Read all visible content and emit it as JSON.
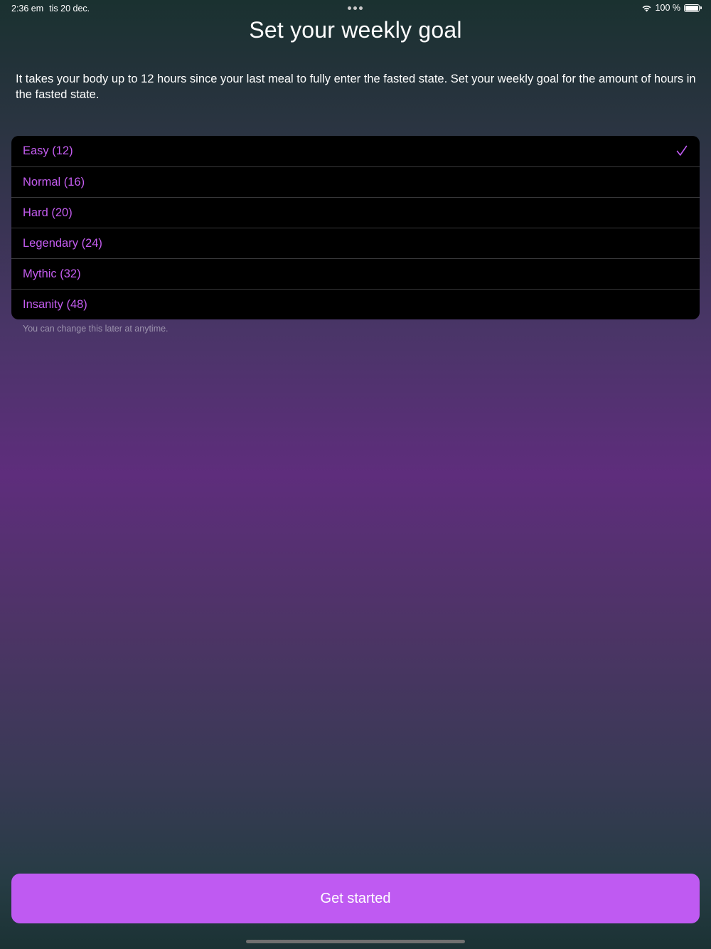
{
  "status_bar": {
    "time": "2:36 em",
    "date": "tis 20 dec.",
    "battery_percent": "100 %",
    "battery_level": 1.0,
    "icons": [
      "wifi-icon",
      "battery-icon"
    ]
  },
  "header": {
    "title": "Set your weekly goal"
  },
  "intro": {
    "text": "It takes your body up to 12 hours since your last meal to fully enter the fasted state. Set your weekly goal for the amount of hours in the fasted state."
  },
  "goals": {
    "options": [
      {
        "label": "Easy (12)",
        "selected": true
      },
      {
        "label": "Normal (16)",
        "selected": false
      },
      {
        "label": "Hard (20)",
        "selected": false
      },
      {
        "label": "Legendary (24)",
        "selected": false
      },
      {
        "label": "Mythic (32)",
        "selected": false
      },
      {
        "label": "Insanity (48)",
        "selected": false
      }
    ],
    "footnote": "You can change this later at anytime."
  },
  "actions": {
    "primary_label": "Get started"
  },
  "colors": {
    "accent": "#bf5af2",
    "option_text": "#c45cf0",
    "list_background": "#000000"
  }
}
